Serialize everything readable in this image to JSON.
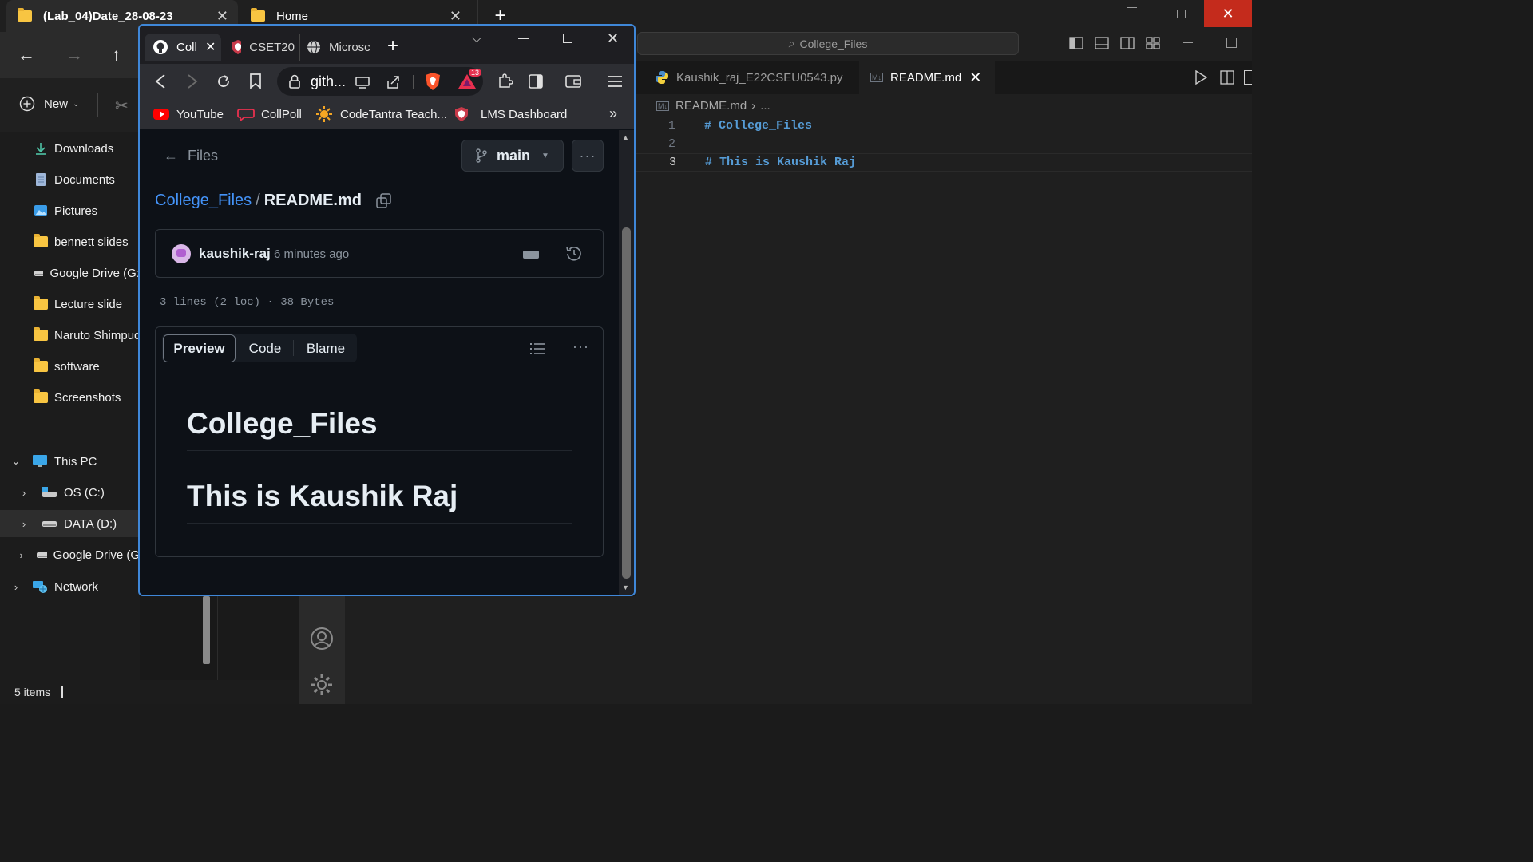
{
  "explorer": {
    "tabs": [
      {
        "label": "(Lab_04)Date_28-08-23",
        "active": true
      },
      {
        "label": "Home",
        "active": false
      }
    ],
    "new_label": "New",
    "sidebar": [
      {
        "label": "Downloads",
        "icon": "download-icon"
      },
      {
        "label": "Documents",
        "icon": "document-icon"
      },
      {
        "label": "Pictures",
        "icon": "pictures-icon"
      },
      {
        "label": "bennett slides",
        "icon": "folder-icon"
      },
      {
        "label": "Google Drive (G:",
        "icon": "drive-icon"
      },
      {
        "label": "Lecture slide",
        "icon": "folder-icon"
      },
      {
        "label": "Naruto Shimpud",
        "icon": "folder-icon"
      },
      {
        "label": "software",
        "icon": "folder-icon"
      },
      {
        "label": "Screenshots",
        "icon": "folder-icon"
      },
      {
        "label": "This PC",
        "icon": "pc-icon"
      },
      {
        "label": "OS (C:)",
        "icon": "disk-icon"
      },
      {
        "label": "DATA (D:)",
        "icon": "drive-icon"
      },
      {
        "label": "Google Drive (G",
        "icon": "drive-icon"
      },
      {
        "label": "Network",
        "icon": "network-icon"
      }
    ],
    "status": "5 items"
  },
  "vscode": {
    "search": "College_Files",
    "tabs": [
      {
        "label": "Kaushik_raj_E22CSEU0543.py",
        "active": false
      },
      {
        "label": "README.md",
        "active": true
      }
    ],
    "breadcrumb": "README.md",
    "breadcrumb_more": "...",
    "lines": [
      {
        "num": "1",
        "text": "# College_Files"
      },
      {
        "num": "2",
        "text": ""
      },
      {
        "num": "3",
        "text": "# This is Kaushik Raj"
      }
    ]
  },
  "browser": {
    "tabs": [
      {
        "label": "Coll",
        "active": true
      },
      {
        "label": "CSET20",
        "active": false
      },
      {
        "label": "Microsc",
        "active": false
      }
    ],
    "url": "gith...",
    "badge_count": "13",
    "bookmarks": [
      "YouTube",
      "CollPoll",
      "CodeTantra Teach...",
      "LMS Dashboard"
    ],
    "bookmarks_more": "»",
    "page": {
      "back_label": "Files",
      "branch": "main",
      "repo": "College_Files",
      "separator": "/",
      "file": "README.md",
      "author": "kaushik-raj",
      "time": "6 minutes ago",
      "file_meta": "3 lines (2 loc) · 38 Bytes",
      "view_tabs": [
        "Preview",
        "Code",
        "Blame"
      ],
      "h1_a": "College_Files",
      "h1_b": "This is Kaushik Raj"
    }
  }
}
